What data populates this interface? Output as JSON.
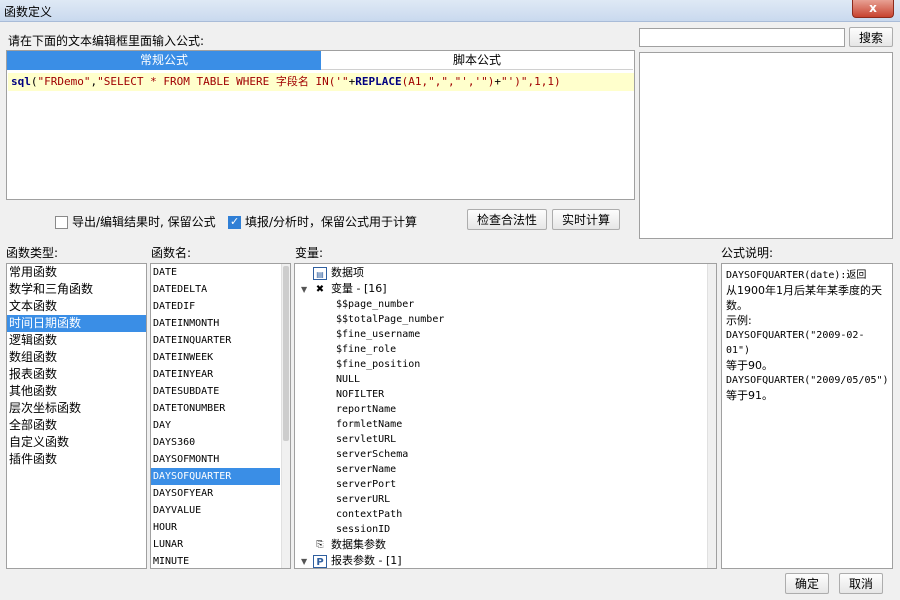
{
  "window": {
    "title": "函数定义",
    "close_label": "x"
  },
  "editor": {
    "instruction": "请在下面的文本编辑框里面输入公式:",
    "tabs": [
      {
        "label": "常规公式"
      },
      {
        "label": "脚本公式"
      }
    ],
    "formula": {
      "fn": "sql",
      "open": "(",
      "arg1": "\"FRDemo\"",
      "comma1": ",",
      "arg2": "\"SELECT * FROM TABLE WHERE 字段名 IN('\"",
      "plus1": "+",
      "fn2": "REPLACE",
      "args2": "(A1,\",\",\"','\")",
      "plus2": "+",
      "arg3": "\"')\"",
      "rest": ",1,1)"
    }
  },
  "search": {
    "placeholder": "",
    "button_label": "搜索"
  },
  "options": {
    "keep_formula_export": {
      "label": "导出/编辑结果时, 保留公式",
      "checked": false
    },
    "keep_formula_fill": {
      "label": "填报/分析时，保留公式用于计算",
      "checked": true
    },
    "check_validity_label": "检查合法性",
    "realtime_calc_label": "实时计算"
  },
  "function_types": {
    "header": "函数类型:",
    "items": [
      "常用函数",
      "数学和三角函数",
      "文本函数",
      "时间日期函数",
      "逻辑函数",
      "数组函数",
      "报表函数",
      "其他函数",
      "层次坐标函数",
      "全部函数",
      "自定义函数",
      "插件函数"
    ],
    "selected_index": 3
  },
  "function_names": {
    "header": "函数名:",
    "items": [
      "DATE",
      "DATEDELTA",
      "DATEDIF",
      "DATEINMONTH",
      "DATEINQUARTER",
      "DATEINWEEK",
      "DATEINYEAR",
      "DATESUBDATE",
      "DATETONUMBER",
      "DAY",
      "DAYS360",
      "DAYSOFMONTH",
      "DAYSOFQUARTER",
      "DAYSOFYEAR",
      "DAYVALUE",
      "HOUR",
      "LUNAR",
      "MINUTE"
    ],
    "selected_index": 12
  },
  "variables": {
    "header": "变量:",
    "data_item_label": "数据项",
    "vars_group_label": "变量 - [16]",
    "vars": [
      "$$page_number",
      "$$totalPage_number",
      "$fine_username",
      "$fine_role",
      "$fine_position",
      "NULL",
      "NOFILTER",
      "reportName",
      "formletName",
      "servletURL",
      "serverSchema",
      "serverName",
      "serverPort",
      "serverURL",
      "contextPath",
      "sessionID"
    ],
    "dataset_params_label": "数据集参数",
    "report_params_label": "报表参数 - [1]"
  },
  "description": {
    "header": "公式说明:",
    "line1": "DAYSOFQUARTER(date):返回",
    "line2": "从1900年1月后某年某季度的天",
    "line3": "数。",
    "line4": "示例:",
    "line5": "DAYSOFQUARTER(\"2009-02-01\")",
    "line6": "等于90。",
    "line7": "DAYSOFQUARTER(\"2009/05/05\")",
    "line8": "等于91。"
  },
  "footer": {
    "ok_label": "确定",
    "cancel_label": "取消"
  },
  "colors": {
    "accent": "#3a8ee6",
    "formula_bg": "#ffffcc"
  }
}
